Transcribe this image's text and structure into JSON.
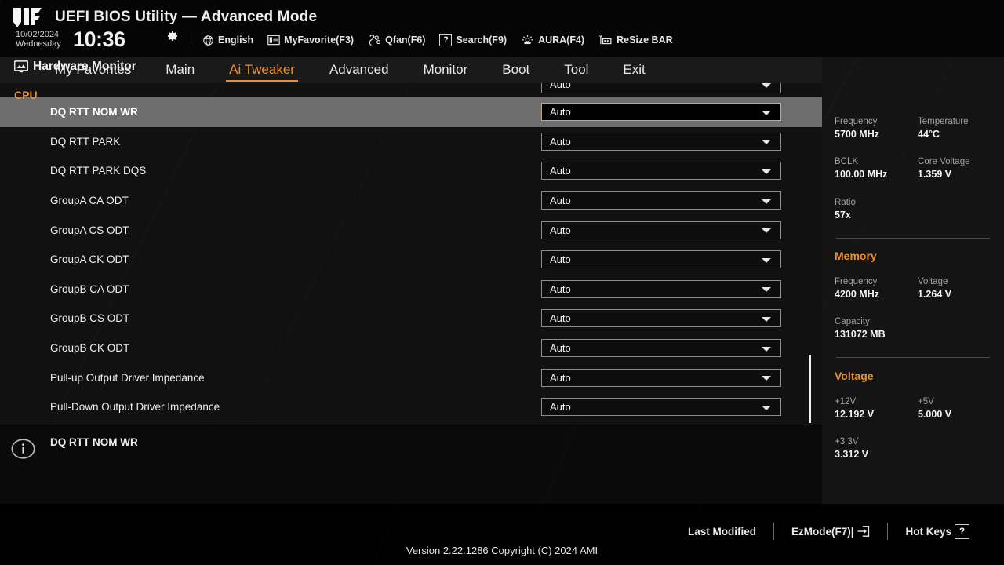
{
  "header": {
    "logo_name": "tuf-gaming-logo",
    "title": "UEFI BIOS Utility — Advanced Mode",
    "date": "10/02/2024",
    "weekday": "Wednesday",
    "time": "10:36",
    "gear_icon": "gear-icon",
    "items": [
      {
        "label": "English",
        "icon": "globe-icon"
      },
      {
        "label": "MyFavorite(F3)",
        "icon": "list-icon"
      },
      {
        "label": "Qfan(F6)",
        "icon": "fan-icon"
      },
      {
        "label": "Search(F9)",
        "icon": "question-box-icon"
      },
      {
        "label": "AURA(F4)",
        "icon": "aura-light-icon"
      },
      {
        "label": "ReSize BAR",
        "icon": "resize-bar-icon"
      }
    ]
  },
  "nav": {
    "active": "Ai Tweaker",
    "accent": "#e8912d",
    "items": [
      {
        "label": "My Favorites"
      },
      {
        "label": "Main"
      },
      {
        "label": "Ai Tweaker"
      },
      {
        "label": "Advanced"
      },
      {
        "label": "Monitor"
      },
      {
        "label": "Boot"
      },
      {
        "label": "Tool"
      },
      {
        "label": "Exit"
      }
    ]
  },
  "main": {
    "partial_row": {
      "label": "",
      "value": "Auto"
    },
    "rows": [
      {
        "label": "DQ RTT NOM WR",
        "value": "Auto",
        "selected": true
      },
      {
        "label": "DQ RTT PARK",
        "value": "Auto",
        "selected": false
      },
      {
        "label": "DQ RTT PARK DQS",
        "value": "Auto",
        "selected": false
      },
      {
        "label": "GroupA CA ODT",
        "value": "Auto",
        "selected": false
      },
      {
        "label": "GroupA CS ODT",
        "value": "Auto",
        "selected": false
      },
      {
        "label": "GroupA CK ODT",
        "value": "Auto",
        "selected": false
      },
      {
        "label": "GroupB CA ODT",
        "value": "Auto",
        "selected": false
      },
      {
        "label": "GroupB CS ODT",
        "value": "Auto",
        "selected": false
      },
      {
        "label": "GroupB CK ODT",
        "value": "Auto",
        "selected": false
      },
      {
        "label": "Pull-up Output Driver Impedance",
        "value": "Auto",
        "selected": false
      },
      {
        "label": "Pull-Down Output Driver Impedance",
        "value": "Auto",
        "selected": false
      }
    ]
  },
  "help": {
    "icon": "info-icon",
    "text": "DQ RTT NOM WR"
  },
  "hardware_monitor": {
    "title": "Hardware Monitor",
    "title_icon": "monitor-icon",
    "sections": [
      {
        "name": "CPU",
        "fields": [
          {
            "key": "Frequency",
            "value": "5700 MHz"
          },
          {
            "key": "Temperature",
            "value": "44°C"
          },
          {
            "key": "BCLK",
            "value": "100.00 MHz"
          },
          {
            "key": "Core Voltage",
            "value": "1.359 V"
          },
          {
            "key": "Ratio",
            "value": "57x"
          }
        ]
      },
      {
        "name": "Memory",
        "fields": [
          {
            "key": "Frequency",
            "value": "4200 MHz"
          },
          {
            "key": "Voltage",
            "value": "1.264 V"
          },
          {
            "key": "Capacity",
            "value": "131072 MB"
          }
        ]
      },
      {
        "name": "Voltage",
        "fields": [
          {
            "key": "+12V",
            "value": "12.192 V"
          },
          {
            "key": "+5V",
            "value": "5.000 V"
          },
          {
            "key": "+3.3V",
            "value": "3.312 V"
          }
        ]
      }
    ]
  },
  "footer": {
    "last_modified": "Last Modified",
    "ezmode": "EzMode(F7)|",
    "ezmode_icon": "exit-arrow-icon",
    "hotkeys": "Hot Keys",
    "hotkeys_key": "?",
    "version": "Version 2.22.1286 Copyright (C) 2024 AMI"
  }
}
